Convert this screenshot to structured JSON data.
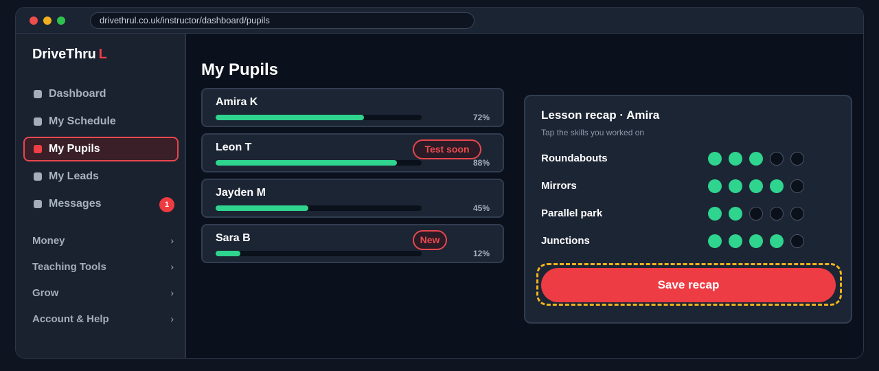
{
  "browser": {
    "url": "drivethrul.co.uk/instructor/dashboard/pupils"
  },
  "sidebar": {
    "logo_main": "DriveThru",
    "logo_accent": "L",
    "nav": [
      {
        "label": "Dashboard",
        "icon": "square-icon",
        "active": false
      },
      {
        "label": "My Schedule",
        "icon": "square-icon",
        "active": false
      },
      {
        "label": "My Pupils",
        "icon": "square-icon",
        "active": true
      },
      {
        "label": "My Leads",
        "icon": "square-icon",
        "active": false
      },
      {
        "label": "Messages",
        "icon": "square-icon",
        "active": false,
        "badge": "1"
      }
    ],
    "groups": [
      {
        "label": "Money",
        "chevron": "›"
      },
      {
        "label": "Teaching Tools",
        "chevron": "›"
      },
      {
        "label": "Grow",
        "chevron": "›"
      },
      {
        "label": "Account & Help",
        "chevron": "›"
      }
    ]
  },
  "main": {
    "title": "My Pupils",
    "pupils": [
      {
        "name": "Amira K",
        "progress": 72,
        "progress_label": "72%",
        "tag": ""
      },
      {
        "name": "Leon T",
        "progress": 88,
        "progress_label": "88%",
        "tag": "Test soon"
      },
      {
        "name": "Jayden M",
        "progress": 45,
        "progress_label": "45%",
        "tag": ""
      },
      {
        "name": "Sara B",
        "progress": 12,
        "progress_label": "12%",
        "tag": "New"
      }
    ],
    "recap": {
      "title": "Lesson recap · Amira",
      "subtitle": "Tap the skills you worked on",
      "skills": [
        {
          "name": "Roundabouts",
          "level": 3,
          "max": 5
        },
        {
          "name": "Mirrors",
          "level": 4,
          "max": 5
        },
        {
          "name": "Parallel park",
          "level": 2,
          "max": 5
        },
        {
          "name": "Junctions",
          "level": 4,
          "max": 5
        }
      ],
      "save_label": "Save recap"
    }
  },
  "colors": {
    "accent": "#ef3f45",
    "progress": "#2fd48e",
    "focus": "#f1b31d",
    "background": "#0b111c"
  }
}
